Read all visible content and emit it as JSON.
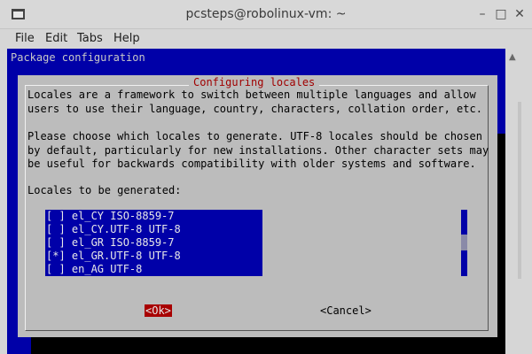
{
  "window": {
    "title": "pcsteps@robolinux-vm: ~"
  },
  "menu": {
    "file": "File",
    "edit": "Edit",
    "tabs": "Tabs",
    "help": "Help"
  },
  "terminal": {
    "header": "Package configuration",
    "dialog": {
      "title": "Configuring locales",
      "paragraph1": [
        "Locales are a framework to switch between multiple languages and allow",
        "users to use their language, country, characters, collation order, etc."
      ],
      "paragraph2": [
        "Please choose which locales to generate. UTF-8 locales should be chosen",
        "by default, particularly for new installations. Other character sets may",
        "be useful for backwards compatibility with older systems and software."
      ],
      "list_label": "Locales to be generated:",
      "items": [
        "[ ] el_CY ISO-8859-7",
        "[ ] el_CY.UTF-8 UTF-8",
        "[ ] el_GR ISO-8859-7",
        "[*] el_GR.UTF-8 UTF-8",
        "[ ] en_AG UTF-8"
      ],
      "ok_label": "<Ok>",
      "cancel_label": "<Cancel>"
    }
  },
  "colors": {
    "terminal_bg": "#0000a8",
    "dialog_bg": "#bcbcbc",
    "title_red": "#a00000",
    "ok_bg": "#a80000"
  }
}
